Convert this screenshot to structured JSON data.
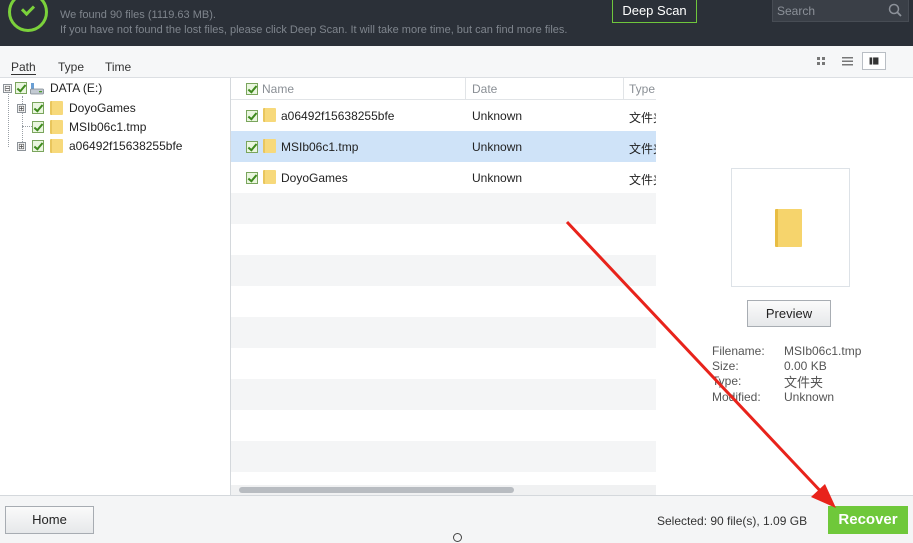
{
  "header": {
    "found_text": "We found 90 files (1119.63 MB).",
    "hint_text": "If you have not found the lost files, please click Deep Scan. It will take more time, but can find more files.",
    "deep_scan_label": "Deep Scan",
    "search_placeholder": "Search"
  },
  "tabs": [
    {
      "label": "Path",
      "active": true
    },
    {
      "label": "Type",
      "active": false
    },
    {
      "label": "Time",
      "active": false
    }
  ],
  "view_modes": [
    "grid-view-icon",
    "list-view-icon",
    "detail-view-icon"
  ],
  "tree": {
    "root": {
      "label": "DATA (E:)",
      "expander": "⊟"
    },
    "items": [
      {
        "label": "DoyoGames",
        "expander": "⊞"
      },
      {
        "label": "MSIb06c1.tmp",
        "expander": ""
      },
      {
        "label": "a06492f15638255bfe",
        "expander": "⊞"
      }
    ]
  },
  "list": {
    "columns": [
      "Name",
      "Date",
      "Type"
    ],
    "rows": [
      {
        "name": "a06492f15638255bfe",
        "date": "Unknown",
        "type": "文件夹",
        "selected": false
      },
      {
        "name": "MSIb06c1.tmp",
        "date": "Unknown",
        "type": "文件夹",
        "selected": true
      },
      {
        "name": "DoyoGames",
        "date": "Unknown",
        "type": "文件夹",
        "selected": false
      }
    ]
  },
  "preview": {
    "button_label": "Preview",
    "meta": [
      {
        "label": "Filename:",
        "value": "MSIb06c1.tmp"
      },
      {
        "label": "Size:",
        "value": "0.00 KB"
      },
      {
        "label": "Type:",
        "value": "文件夹"
      },
      {
        "label": "Modified:",
        "value": "Unknown"
      }
    ]
  },
  "footer": {
    "home_label": "Home",
    "selected_text": "Selected: 90 file(s), 1.09 GB",
    "recover_label": "Recover"
  },
  "colors": {
    "header_bg": "#2b3038",
    "accent_green": "#6fc83a",
    "selected_row": "#cfe3f8",
    "annotation_red": "#e8231b"
  }
}
